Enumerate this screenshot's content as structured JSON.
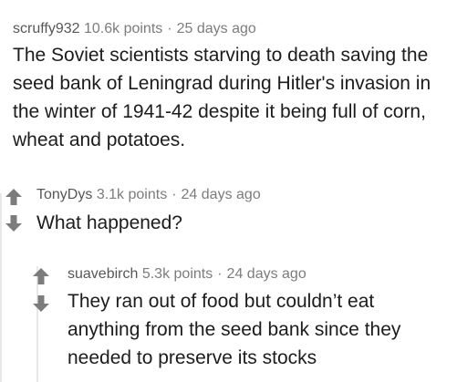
{
  "comments": [
    {
      "author": "scruffy932",
      "points": "10.6k points",
      "separator": "·",
      "age": "25 days ago",
      "body": "The Soviet scientists starving to death saving the seed bank of Leningrad during Hitler's invasion in the winter of 1941-42 despite it being full of corn, wheat and potatoes."
    },
    {
      "author": "TonyDys",
      "points": "3.1k points",
      "separator": "·",
      "age": "24 days ago",
      "body": "What happened?"
    },
    {
      "author": "suavebirch",
      "points": "5.3k points",
      "separator": "·",
      "age": "24 days ago",
      "body": "They ran out of food but couldn’t eat anything from the seed bank since they needed to preserve its stocks"
    }
  ],
  "icons": {
    "upvote": "upvote-arrow-icon",
    "downvote": "downvote-arrow-icon"
  },
  "colors": {
    "arrow": "#7c7c7c",
    "meta": "#7c7c7c",
    "body": "#1c1c1c",
    "thread_line": "#e8e8e8"
  }
}
